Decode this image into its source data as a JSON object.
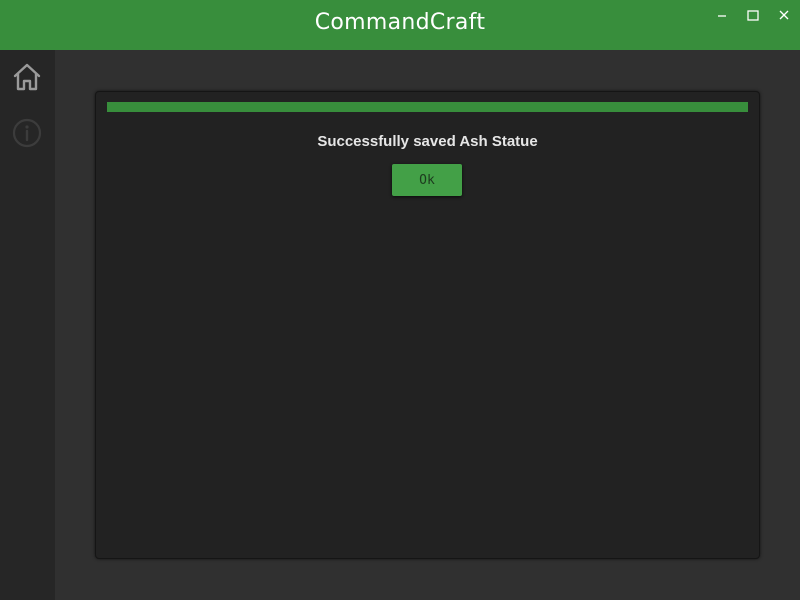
{
  "window": {
    "title": "CommandCraft",
    "controls": [
      "minimize-icon",
      "maximize-icon",
      "close-icon"
    ]
  },
  "sidebar": {
    "items": [
      {
        "icon": "home-icon",
        "state": "active"
      },
      {
        "icon": "info-icon",
        "state": "inactive"
      }
    ]
  },
  "dialog": {
    "progress": 1.0,
    "message": "Successfully saved Ash Statue",
    "ok_label": "Ok"
  },
  "colors": {
    "accent": "#388e3c",
    "button": "#43a047",
    "background": "#303030",
    "sidebar": "#262626",
    "dialog": "#222222"
  }
}
